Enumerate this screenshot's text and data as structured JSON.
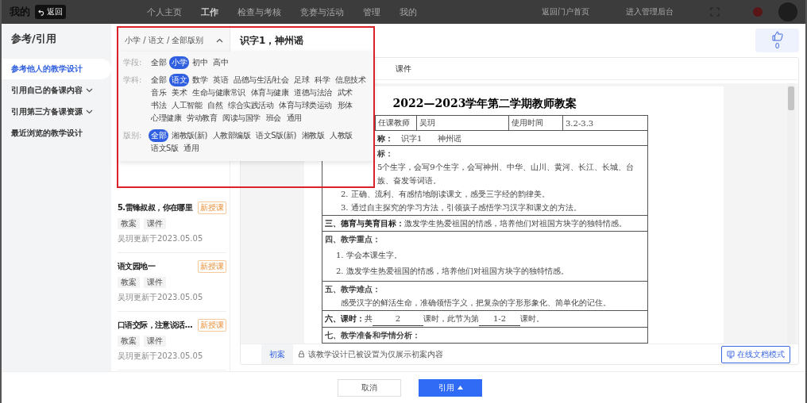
{
  "top_bar": {
    "brand": "我的",
    "back_button": "返回",
    "nav": [
      {
        "label": "个人主页",
        "selected": false
      },
      {
        "label": "工作",
        "selected": true
      },
      {
        "label": "检查与考核",
        "selected": false
      },
      {
        "label": "竞赛与活动",
        "selected": false
      },
      {
        "label": "管理",
        "selected": false
      },
      {
        "label": "我的",
        "selected": false
      }
    ],
    "portal_link": "返回门户首页",
    "admin_link": "进入管理后台"
  },
  "sidebar": {
    "title": "参考/引用",
    "items": [
      {
        "label": "参考他人的教学设计",
        "selected": true,
        "expandable": false
      },
      {
        "label": "引用自己的备课内容",
        "selected": false,
        "expandable": true
      },
      {
        "label": "引用第三方备课资源",
        "selected": false,
        "expandable": true
      },
      {
        "label": "最近浏览的教学设计",
        "selected": false,
        "expandable": false
      }
    ]
  },
  "filter": {
    "breadcrumb": "小学 / 语文 / 全部版别",
    "expanded": true,
    "groups": [
      {
        "label": "学段:",
        "options": [
          {
            "label": "全部",
            "selected": false
          },
          {
            "label": "小学",
            "selected": true
          },
          {
            "label": "初中",
            "selected": false
          },
          {
            "label": "高中",
            "selected": false
          }
        ]
      },
      {
        "label": "学科:",
        "options": [
          {
            "label": "全部",
            "selected": false
          },
          {
            "label": "语文",
            "selected": true
          },
          {
            "label": "数学",
            "selected": false
          },
          {
            "label": "英语",
            "selected": false
          },
          {
            "label": "品德与生活/社会",
            "selected": false
          },
          {
            "label": "足球",
            "selected": false
          },
          {
            "label": "科学",
            "selected": false
          },
          {
            "label": "信息技术",
            "selected": false
          },
          {
            "label": "音乐",
            "selected": false
          },
          {
            "label": "美术",
            "selected": false
          },
          {
            "label": "生命与健康常识",
            "selected": false
          },
          {
            "label": "体育与健康",
            "selected": false
          },
          {
            "label": "道德与法治",
            "selected": false
          },
          {
            "label": "武术",
            "selected": false
          },
          {
            "label": "书法",
            "selected": false
          },
          {
            "label": "人工智能",
            "selected": false
          },
          {
            "label": "自然",
            "selected": false
          },
          {
            "label": "综合实践活动",
            "selected": false
          },
          {
            "label": "体育与球类运动",
            "selected": false
          },
          {
            "label": "形体",
            "selected": false
          },
          {
            "label": "心理健康",
            "selected": false
          },
          {
            "label": "劳动教育",
            "selected": false
          },
          {
            "label": "阅读与国学",
            "selected": false
          },
          {
            "label": "班会",
            "selected": false
          },
          {
            "label": "通用",
            "selected": false
          }
        ]
      },
      {
        "label": "版别:",
        "options": [
          {
            "label": "全部",
            "selected": true
          },
          {
            "label": "湘教版(新)",
            "selected": false
          },
          {
            "label": "人教部编版",
            "selected": false
          },
          {
            "label": "语文S版(新)",
            "selected": false
          },
          {
            "label": "湘教版",
            "selected": false
          },
          {
            "label": "人教版",
            "selected": false
          },
          {
            "label": "语文S版",
            "selected": false
          },
          {
            "label": "通用",
            "selected": false
          }
        ]
      }
    ]
  },
  "lessons": [
    {
      "title": "5.雷锋叔叔，你在哪里",
      "badge": "新授课",
      "tags": [
        "教案",
        "课件"
      ],
      "meta": "吴玥更新于2023.05.05"
    },
    {
      "title": "语文园地一",
      "badge": "新授课",
      "tags": [
        "教案",
        "课件"
      ],
      "meta": "吴玥更新于2023.05.05"
    },
    {
      "title": "口语交际，注意说话...",
      "badge": "新授课",
      "tags": [
        "教案",
        "课件"
      ],
      "meta": "吴玥更新于2023.05.05"
    }
  ],
  "detail": {
    "title": "识字1，神州谣",
    "likes": "0",
    "tabs": [
      {
        "label": "课件",
        "selected": false
      }
    ],
    "doc": {
      "title": "2022—2023学年第二学期教师教案",
      "info_row": [
        "任课教师",
        "吴玥",
        "使用时间",
        "3.2-3.3"
      ],
      "lesson_label": "称：",
      "lesson_value": "识字1　　神州谣",
      "sections": [
        {
          "lines": [
            {
              "kind": "clipped-heading",
              "text": "标："
            },
            {
              "kind": "clipped",
              "text": "5个生字，会写9个生字，会写神州、中华、山川、黄河、长江、长城、台"
            },
            {
              "kind": "clipped",
              "text": "族、奋发等词语。"
            },
            {
              "kind": "indent",
              "text": "2. 正确、流利、有感情地朗读课文，感受三字经的韵律美。"
            },
            {
              "kind": "indent",
              "text": "3. 通过自主探究的学习方法，引领孩子感悟学习汉字和课文的方法。"
            }
          ]
        },
        {
          "lines": [
            {
              "kind": "body",
              "text": "**三、德育与美育目标：**激发学生热爱祖国的情感，培养他们对祖国方块字的独特情感。"
            }
          ]
        },
        {
          "lines": [
            {
              "kind": "heading",
              "text": "四、教学重点："
            },
            {
              "kind": "spaced",
              "text": "1. 学会本课生字。"
            },
            {
              "kind": "spaced",
              "text": "2. 激发学生热爱祖国的情感，培养他们对祖国方块字的独特情感。"
            }
          ]
        },
        {
          "lines": [
            {
              "kind": "heading",
              "text": "五、教学难点："
            },
            {
              "kind": "indent",
              "text": "感受汉字的鲜活生命，准确领悟字义，把复杂的字形形象化、简单化的记住。"
            }
          ]
        },
        {
          "lines": [
            {
              "kind": "hours",
              "label": "六、课时：",
              "before": "共",
              "total": "2",
              "middle": "课时，此节为第",
              "current": "1-2",
              "after": "课时。"
            }
          ]
        },
        {
          "lines": [
            {
              "kind": "heading",
              "text": "七、教学准备和学情分析："
            }
          ]
        }
      ]
    },
    "version_tab": "初案",
    "notice": "该教学设计已被设置为仅展示初案内容",
    "mode_button": "在线文档模式"
  },
  "footer": {
    "cancel": "取消",
    "confirm": "引用"
  }
}
